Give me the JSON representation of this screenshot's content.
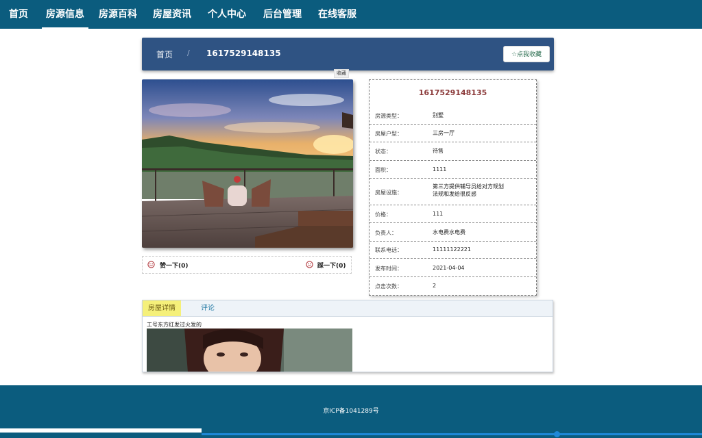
{
  "nav": {
    "items": [
      {
        "label": "首页"
      },
      {
        "label": "房源信息"
      },
      {
        "label": "房源百科"
      },
      {
        "label": "房屋资讯"
      },
      {
        "label": "个人中心"
      },
      {
        "label": "后台管理"
      },
      {
        "label": "在线客服"
      }
    ],
    "active": "房源信息"
  },
  "breadcrumb": {
    "home": "首页",
    "separator": "/",
    "current": "1617529148135"
  },
  "favorite": {
    "button_label": "☆点我收藏",
    "mini_label": "收藏"
  },
  "likes": {
    "like_label": "赞一下(0)",
    "dislike_label": "踩一下(0)"
  },
  "house": {
    "title": "1617529148135",
    "fields": [
      {
        "label": "房源类型：",
        "value": "别墅"
      },
      {
        "label": "房屋户型：",
        "value": "三房一厅"
      },
      {
        "label": "状态：",
        "value": "待售"
      },
      {
        "label": "面积：",
        "value": "1111"
      },
      {
        "label": "房屋设施：",
        "value": "第三方提供辅导员给对方规划法规和发给很反感"
      },
      {
        "label": "价格：",
        "value": "111"
      },
      {
        "label": "负责人：",
        "value": "水电费水电费"
      },
      {
        "label": "联系电话：",
        "value": "11111122221"
      },
      {
        "label": "发布时间：",
        "value": "2021-04-04"
      },
      {
        "label": "点击次数：",
        "value": "2"
      }
    ]
  },
  "tabs": {
    "items": [
      {
        "label": "房屋详情"
      },
      {
        "label": "评论"
      }
    ],
    "active": "房屋详情",
    "content_text": "工号东方红发过火发的"
  },
  "footer": {
    "icp": "京ICP备1041289号"
  },
  "colors": {
    "nav_bg": "#0b5c7e",
    "crumb_bg": "#2f5383",
    "title_color": "#8b3a3a",
    "tab_active_bg": "#f5f07a"
  }
}
